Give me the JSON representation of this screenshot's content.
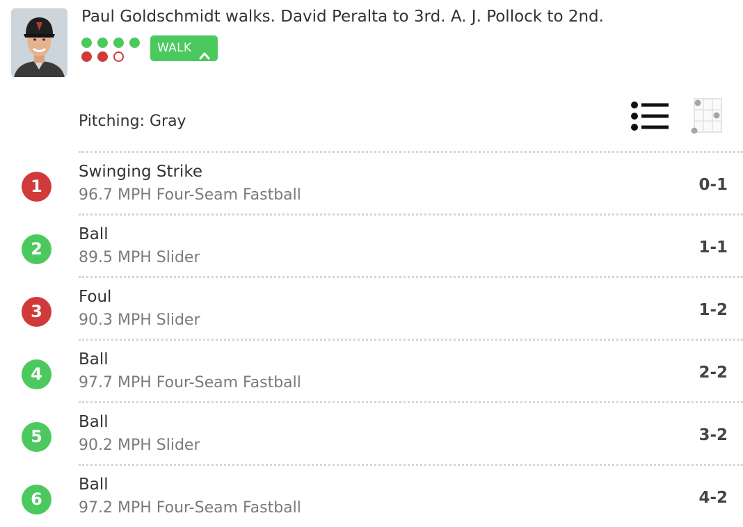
{
  "header": {
    "play_description": "Paul Goldschmidt walks. David Peralta to 3rd. A. J. Pollock to 2nd.",
    "result_label": "WALK",
    "result_icon": "chevron-up-icon",
    "balls": 4,
    "strikes": 2,
    "colors": {
      "ball": "#4cc95e",
      "strike": "#d13a3a"
    }
  },
  "pitching": {
    "label": "Pitching: Gray",
    "list_view_icon": "list-view-icon",
    "zone_view_icon": "strike-zone-icon"
  },
  "pitches": [
    {
      "number": "1",
      "kind": "strike",
      "result": "Swinging Strike",
      "detail": "96.7 MPH Four-Seam Fastball",
      "count": "0-1"
    },
    {
      "number": "2",
      "kind": "ball",
      "result": "Ball",
      "detail": "89.5 MPH Slider",
      "count": "1-1"
    },
    {
      "number": "3",
      "kind": "strike",
      "result": "Foul",
      "detail": "90.3 MPH Slider",
      "count": "1-2"
    },
    {
      "number": "4",
      "kind": "ball",
      "result": "Ball",
      "detail": "97.7 MPH Four-Seam Fastball",
      "count": "2-2"
    },
    {
      "number": "5",
      "kind": "ball",
      "result": "Ball",
      "detail": "90.2 MPH Slider",
      "count": "3-2"
    },
    {
      "number": "6",
      "kind": "ball",
      "result": "Ball",
      "detail": "97.2 MPH Four-Seam Fastball",
      "count": "4-2"
    }
  ]
}
